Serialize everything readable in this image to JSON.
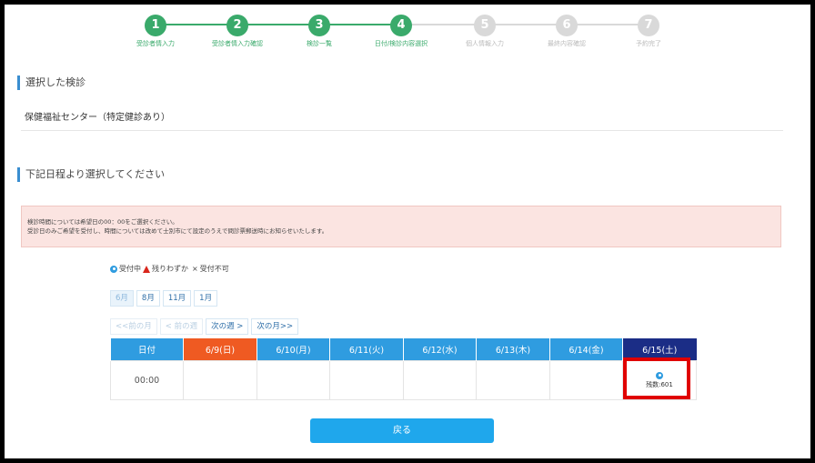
{
  "steps": [
    {
      "num": "1",
      "label": "受診者情入力",
      "state": "done"
    },
    {
      "num": "2",
      "label": "受診者情入力確認",
      "state": "done"
    },
    {
      "num": "3",
      "label": "検診一覧",
      "state": "done"
    },
    {
      "num": "4",
      "label": "日付/検診内容選択",
      "state": "current"
    },
    {
      "num": "5",
      "label": "個人情報入力",
      "state": "todo"
    },
    {
      "num": "6",
      "label": "最終内容確認",
      "state": "todo"
    },
    {
      "num": "7",
      "label": "予約完了",
      "state": "todo"
    }
  ],
  "colors": {
    "step_done": "#3aaa6b",
    "step_todo": "#d9d9d9",
    "accent": "#2f9ce0",
    "sunday": "#ef5a22",
    "saturday": "#1b2d86",
    "highlight": "#e00000"
  },
  "selected_exam": {
    "heading": "選択した検診",
    "value": "保健福祉センター（特定健診あり）"
  },
  "schedule": {
    "heading": "下記日程より選択してください"
  },
  "notice": {
    "line1": "検診時間については希望日の00：00をご選択ください。",
    "line2": "受診日のみご希望を受付し、時間については改めて士別市にて設定のうえで問診票郵送時にお知らせいたします。"
  },
  "legend": {
    "accepting": "受付中",
    "few_left": "残りわずか",
    "closed": "受付不可",
    "icons": [
      "circle-icon",
      "triangle-icon",
      "cross-icon"
    ]
  },
  "months": [
    {
      "label": "6月",
      "active": true
    },
    {
      "label": "8月",
      "active": false
    },
    {
      "label": "11月",
      "active": false
    },
    {
      "label": "1月",
      "active": false
    }
  ],
  "nav": {
    "prev_month": "<<前の月",
    "prev_week": "< 前の週",
    "next_week": "次の週 >",
    "next_month": "次の月>>"
  },
  "calendar": {
    "header_label": "日付",
    "days": [
      "6/9(日)",
      "6/10(月)",
      "6/11(火)",
      "6/12(水)",
      "6/13(木)",
      "6/14(金)",
      "6/15(土)"
    ],
    "time": "00:00",
    "availability": [
      "",
      "",
      "",
      "",
      "",
      "",
      "残数:601"
    ]
  },
  "back_button": "戻る"
}
